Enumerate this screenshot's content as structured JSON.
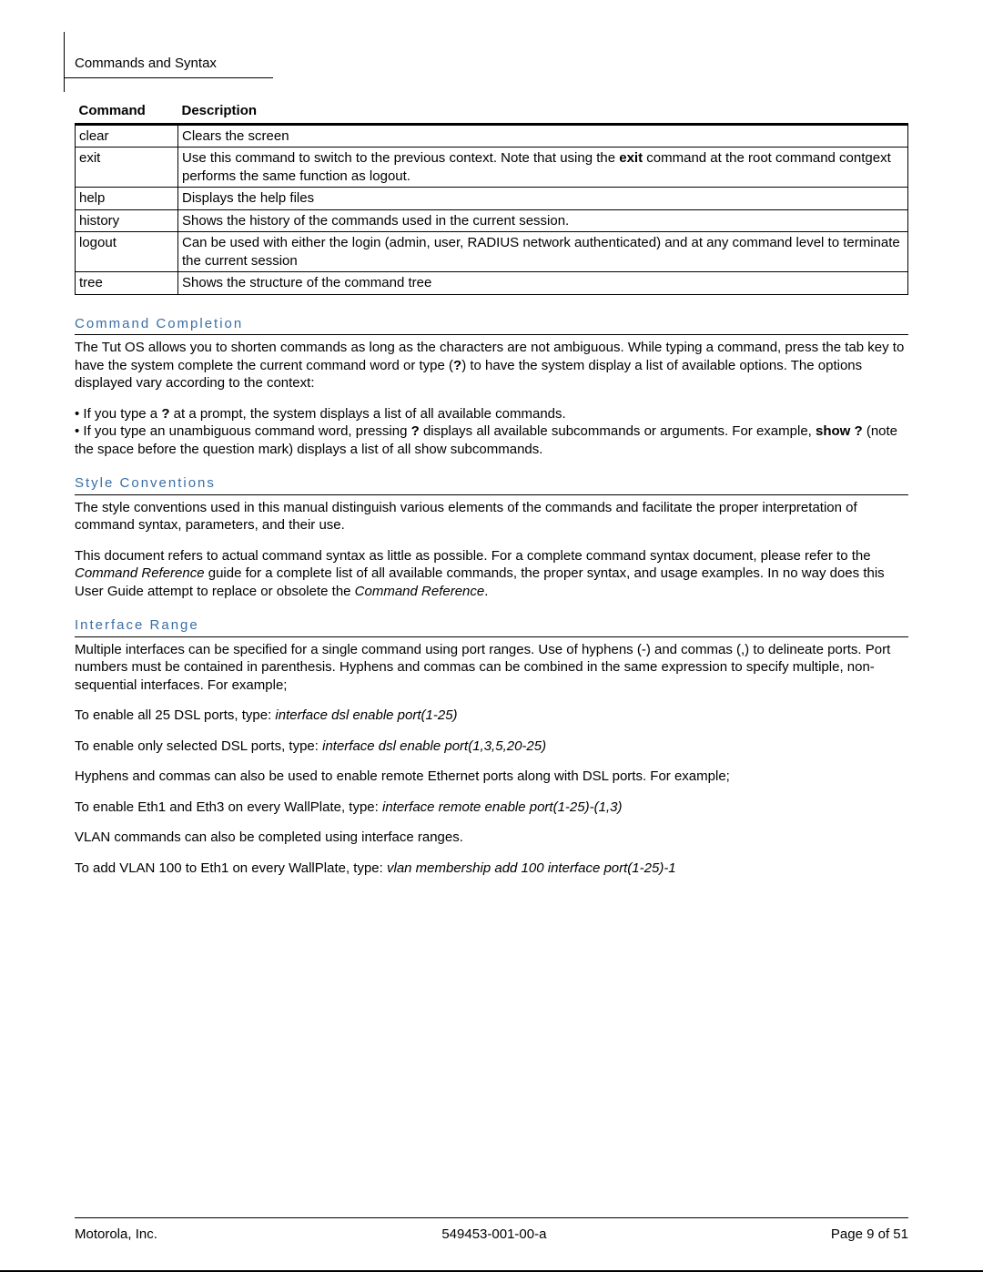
{
  "header": {
    "section_title": "Commands and Syntax"
  },
  "table": {
    "headers": {
      "col1": "Command",
      "col2": "Description"
    },
    "rows": [
      {
        "cmd": "clear",
        "desc": "Clears the screen"
      },
      {
        "cmd": "exit",
        "desc_pre": "Use this command to switch to the previous context.  Note that using the ",
        "desc_bold": "exit",
        "desc_post": " command at the root command contgext performs the same function as logout."
      },
      {
        "cmd": "help",
        "desc": "Displays the help files"
      },
      {
        "cmd": "history",
        "desc": "Shows the history of the commands used in the current session."
      },
      {
        "cmd": "logout",
        "desc": "Can be used with either the login (admin, user, RADIUS network authenticated) and at any command level to terminate the current session"
      },
      {
        "cmd": "tree",
        "desc": "Shows the structure of the command tree"
      }
    ]
  },
  "sections": {
    "cc": {
      "title": "Command Completion",
      "p1_a": "The Tut OS allows you to shorten commands as long as the characters are not ambiguous. While typing a command, press the tab key to have the system complete the current command word or type (",
      "p1_b": "?",
      "p1_c": ") to have the system display a list of available options. The options displayed vary according to the context:",
      "b1_a": "• If you type a ",
      "b1_b": "?",
      "b1_c": " at a prompt, the system displays a list of all available commands.",
      "b2_a": "• If you type an unambiguous command word, pressing ",
      "b2_b": "?",
      "b2_c": " displays all available subcommands or arguments. For example, ",
      "b2_d": "show ?",
      "b2_e": " (note the space before the question mark) displays a list of all show subcommands."
    },
    "sc": {
      "title": "Style Conventions",
      "p1": "The style conventions used in this manual distinguish various elements of the commands and facilitate the proper interpretation of command syntax, parameters, and their use.",
      "p2_a": "This document refers to actual command syntax as little as possible.  For a complete command syntax document, please refer to the ",
      "p2_b": "Command Reference",
      "p2_c": " guide for a complete list of all available commands, the proper syntax, and usage examples.  In no way does this User Guide attempt to replace or obsolete the ",
      "p2_d": "Command Reference",
      "p2_e": "."
    },
    "ir": {
      "title": "Interface Range",
      "p1": "Multiple interfaces can be specified for a single command using port ranges.  Use of hyphens (-) and commas (,) to delineate ports.  Port numbers must be contained in parenthesis.  Hyphens and commas can be combined in the same expression to specify multiple, non-sequential interfaces.  For example;",
      "p2_a": "To enable all 25 DSL ports, type:  ",
      "p2_b": "interface dsl enable port(1-25)",
      "p3_a": "To enable only selected DSL ports, type:  ",
      "p3_b": "interface dsl enable port(1,3,5,20-25)",
      "p4": "Hyphens and commas can also be used to enable remote Ethernet ports along with DSL ports.  For example;",
      "p5_a": "To enable Eth1 and Eth3 on every WallPlate, type:  ",
      "p5_b": "interface remote enable port(1-25)-(1,3)",
      "p6": "VLAN commands can also be completed using interface ranges.",
      "p7_a": "To add VLAN 100 to Eth1 on every WallPlate, type:  ",
      "p7_b": "vlan membership add 100 interface port(1-25)-1"
    }
  },
  "footer": {
    "left": "Motorola, Inc.",
    "center": "549453-001-00-a",
    "right": "Page 9 of 51"
  }
}
